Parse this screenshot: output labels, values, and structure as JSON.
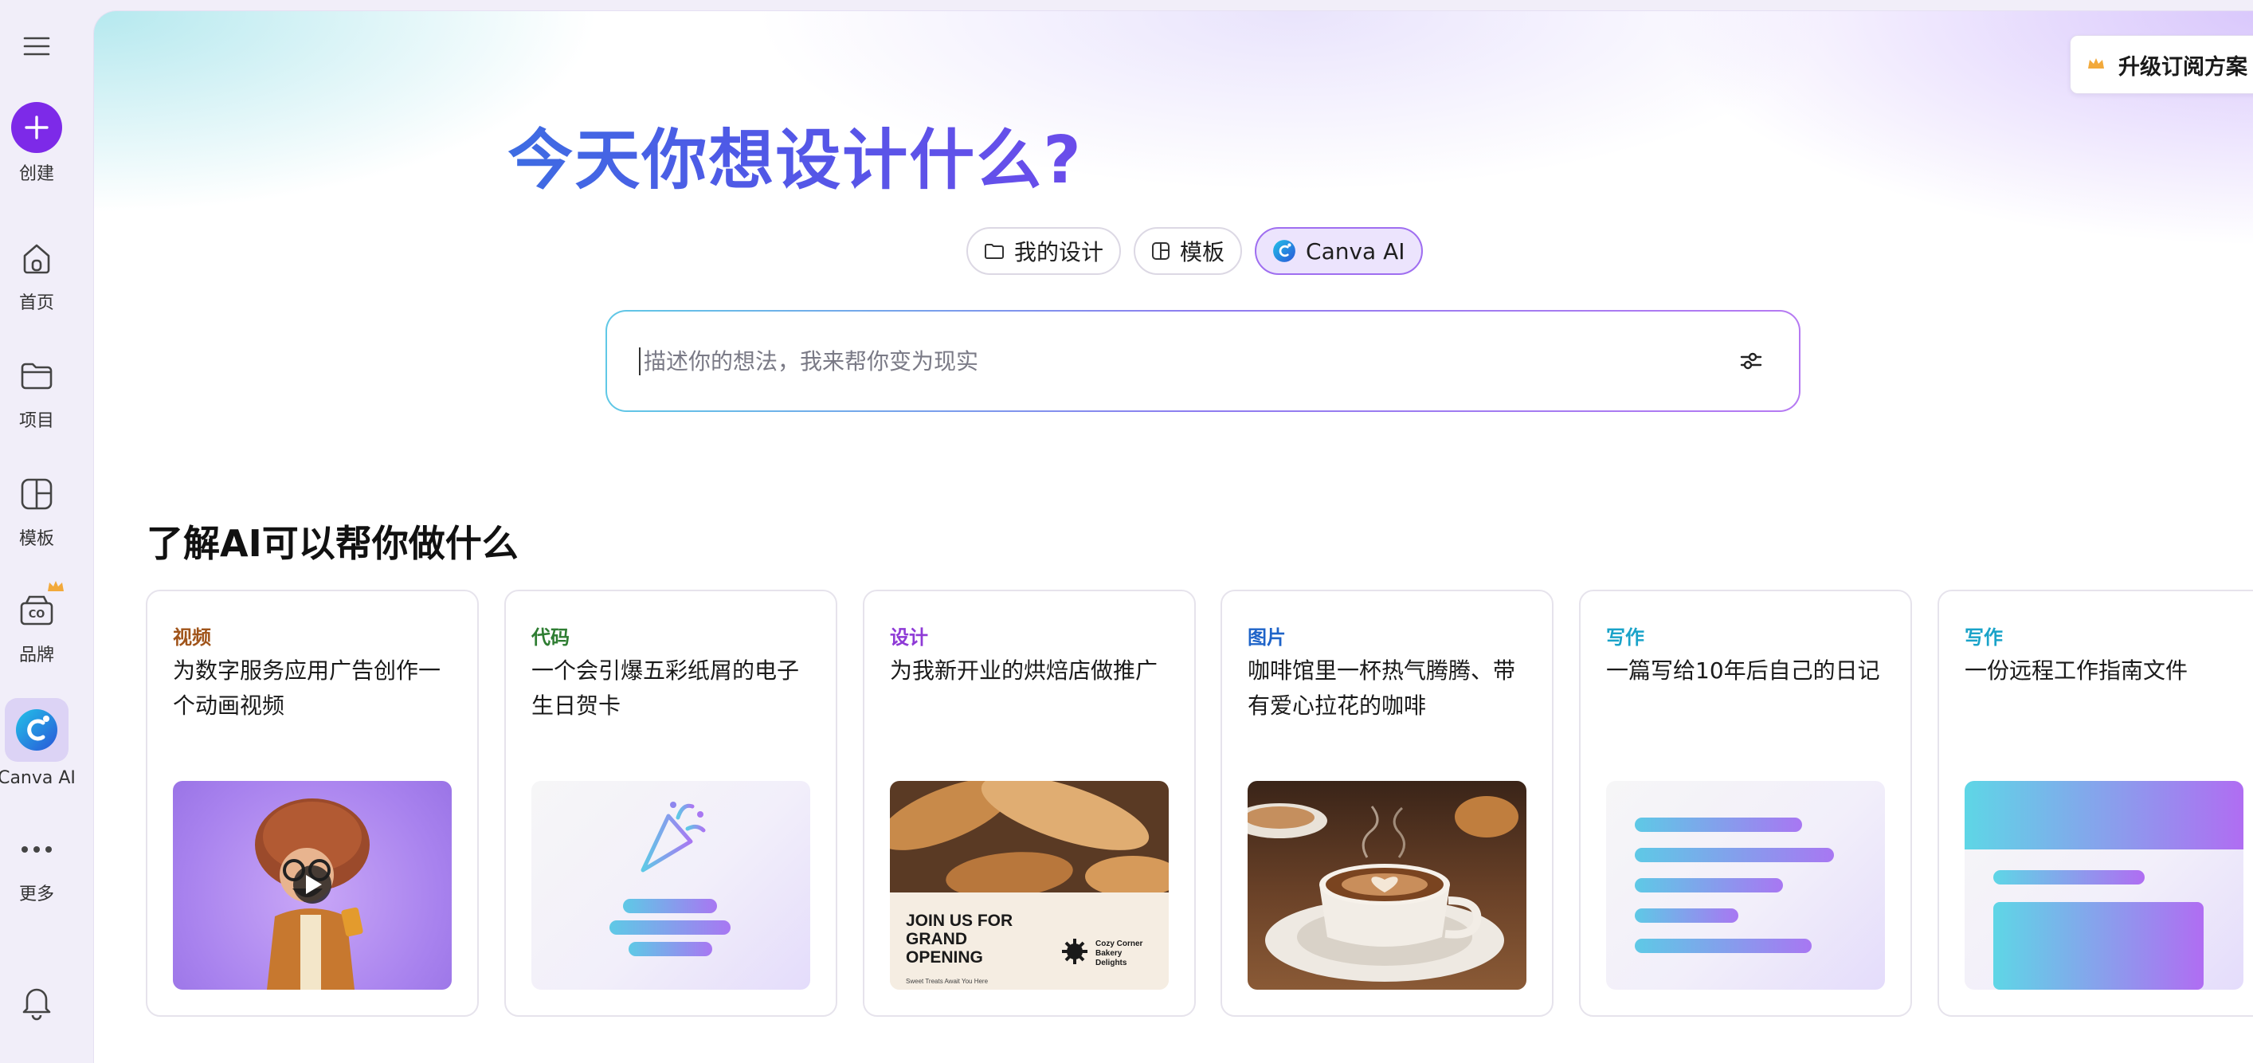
{
  "sidebar": {
    "menu_icon": "hamburger-menu-icon",
    "items": [
      {
        "label": "创建",
        "icon": "plus-icon"
      },
      {
        "label": "首页",
        "icon": "home-icon"
      },
      {
        "label": "项目",
        "icon": "folder-icon"
      },
      {
        "label": "模板",
        "icon": "template-icon"
      },
      {
        "label": "品牌",
        "icon": "brand-icon"
      },
      {
        "label": "Canva AI",
        "icon": "canva-ai-icon"
      },
      {
        "label": "更多",
        "icon": "more-dots-icon"
      }
    ],
    "bell_icon": "bell-icon"
  },
  "header": {
    "upgrade_label": "升级订阅方案",
    "title": "今天你想设计什么?"
  },
  "tabs": [
    {
      "label": "我的设计",
      "icon": "folder-outline-icon"
    },
    {
      "label": "模板",
      "icon": "template-outline-icon"
    },
    {
      "label": "Canva AI",
      "icon": "canva-ai-icon",
      "active": true
    }
  ],
  "search": {
    "placeholder": "描述你的想法，我来帮你变为现实"
  },
  "section": {
    "title": "了解AI可以帮你做什么"
  },
  "cards": [
    {
      "category": "视频",
      "text": "为数字服务应用广告创作一个动画视频",
      "color": "#a0541a"
    },
    {
      "category": "代码",
      "text": "一个会引爆五彩纸屑的电子生日贺卡",
      "color": "#2e7d32"
    },
    {
      "category": "设计",
      "text": "为我新开业的烘焙店做推广",
      "color": "#8e3ad6",
      "poster": {
        "headline1": "JOIN US FOR",
        "headline2": "GRAND",
        "headline3": "OPENING",
        "brand1": "Cozy Corner",
        "brand2": "Bakery",
        "brand3": "Delights",
        "tagline": "Sweet Treats Await You Here"
      }
    },
    {
      "category": "图片",
      "text": "咖啡馆里一杯热气腾腾、带有爱心拉花的咖啡",
      "color": "#1e63c8"
    },
    {
      "category": "写作",
      "text": "一篇写给10年后自己的日记",
      "color": "#1aa3c9"
    },
    {
      "category": "写作",
      "text": "一份远程工作指南文件",
      "color": "#1aa3c9"
    }
  ],
  "colors": {
    "brand_purple": "#7d2ae8",
    "title_gradient_start": "#1d8fdc",
    "title_gradient_end": "#8b3cf0"
  }
}
